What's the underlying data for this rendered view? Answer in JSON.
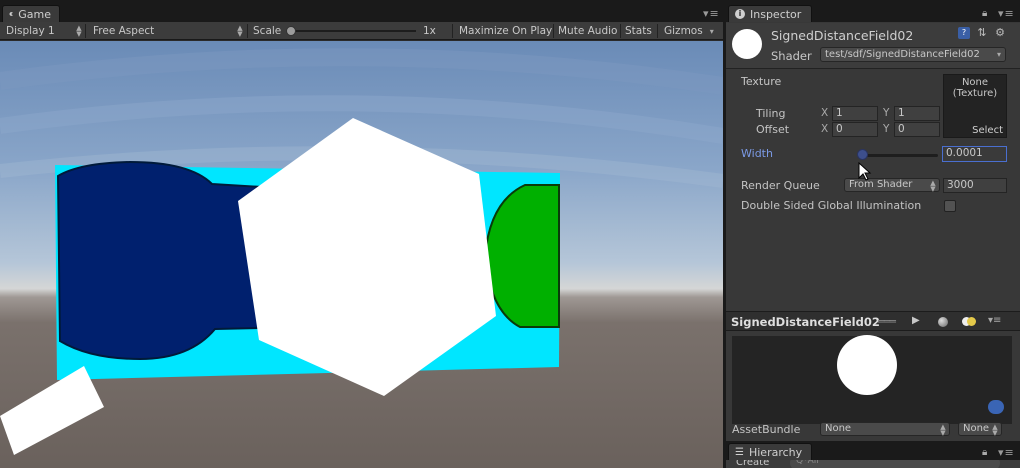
{
  "game": {
    "tab_label": "Game",
    "toolbar": {
      "display": "Display 1",
      "aspect": "Free Aspect",
      "scale_label": "Scale",
      "scale_value": "1x",
      "maximize": "Maximize On Play",
      "mute": "Mute Audio",
      "stats": "Stats",
      "gizmos": "Gizmos"
    },
    "colors": {
      "cyan_quad": "#00e6ff",
      "navy_shape": "#00206e",
      "green_shape": "#00b000",
      "hexagon": "#ffffff"
    }
  },
  "inspector": {
    "tab_label": "Inspector",
    "material_name": "SignedDistanceField02",
    "shader_label": "Shader",
    "shader_value": "test/sdf/SignedDistanceField02",
    "texture_label": "Texture",
    "texture_none": "None",
    "texture_type": "(Texture)",
    "texture_select": "Select",
    "tiling_label": "Tiling",
    "offset_label": "Offset",
    "x_label": "X",
    "y_label": "Y",
    "tiling_x": "1",
    "tiling_y": "1",
    "offset_x": "0",
    "offset_y": "0",
    "width_label": "Width",
    "width_value": "0.0001",
    "render_queue_label": "Render Queue",
    "render_queue_mode": "From Shader",
    "render_queue_value": "3000",
    "double_sided_label": "Double Sided Global Illumination",
    "preview_title": "SignedDistanceField02",
    "assetbundle_label": "AssetBundle",
    "assetbundle_value": "None",
    "assetbundle_variant": "None"
  },
  "hierarchy": {
    "tab_label": "Hierarchy",
    "create_label": "Create",
    "search_placeholder": "Q*All"
  }
}
